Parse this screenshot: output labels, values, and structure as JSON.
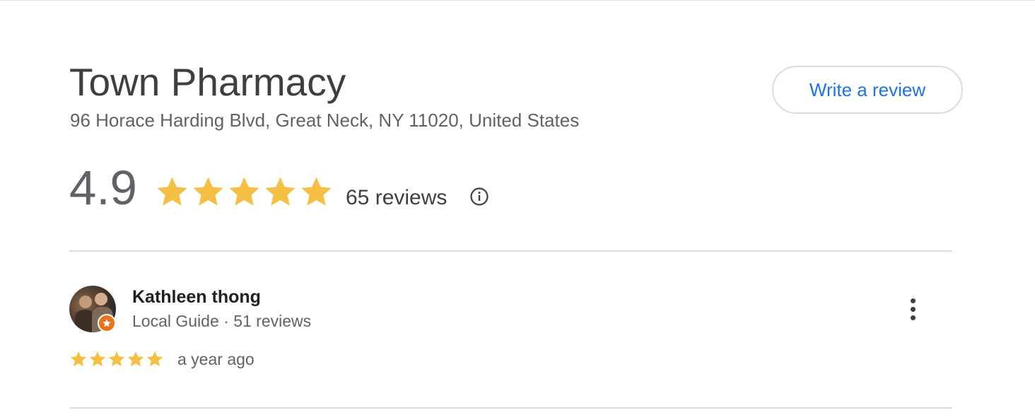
{
  "place": {
    "name": "Town Pharmacy",
    "address": "96 Horace Harding Blvd, Great Neck, NY 11020, United States",
    "write_review_label": "Write a review"
  },
  "rating": {
    "value": "4.9",
    "stars_filled": 5,
    "stars_total": 5,
    "review_count_label": "65 reviews",
    "info_icon": "info-icon"
  },
  "review": {
    "reviewer_name": "Kathleen thong",
    "reviewer_meta": "Local Guide · 51 reviews",
    "stars_filled": 5,
    "stars_total": 5,
    "date": "a year ago",
    "badge_icon": "local-guide-star-icon",
    "menu_icon": "more-vert-icon"
  },
  "colors": {
    "star": "#f4bf42",
    "accent_link": "#1a73e8",
    "local_guide_badge": "#e8711c",
    "divider": "#dadce0"
  }
}
